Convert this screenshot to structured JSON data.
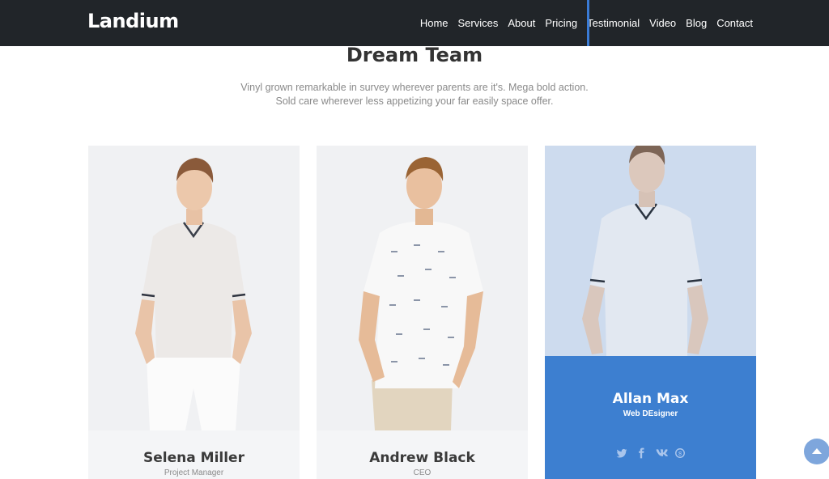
{
  "header": {
    "brand": "Landium",
    "nav": [
      "Home",
      "Services",
      "About",
      "Pricing",
      "Testimonial",
      "Video",
      "Blog",
      "Contact"
    ],
    "active_index": 4
  },
  "section": {
    "title": "Dream Team",
    "subtitle_line1": "Vinyl grown remarkable in survey wherever parents are it's. Mega bold action.",
    "subtitle_line2": "Sold care wherever less appetizing your far easily space offer."
  },
  "team": [
    {
      "name": "Selena Miller",
      "role": "Project Manager"
    },
    {
      "name": "Andrew Black",
      "role": "CEO"
    },
    {
      "name": "Allan Max",
      "role": "Web DEsigner"
    }
  ],
  "social_icons": [
    "twitter-icon",
    "facebook-icon",
    "vk-icon",
    "skype-icon"
  ],
  "colors": {
    "navbar": "#212529",
    "accent": "#3d7fd0",
    "scroll_button": "#7ea6dc"
  }
}
